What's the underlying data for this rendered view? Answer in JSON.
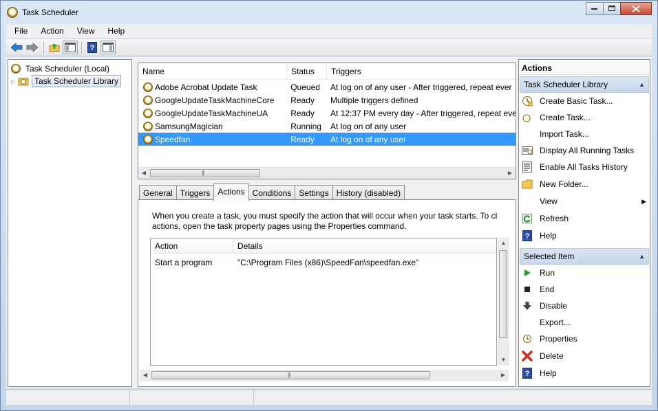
{
  "window": {
    "title": "Task Scheduler"
  },
  "menu": [
    "File",
    "Action",
    "View",
    "Help"
  ],
  "tree": {
    "root": "Task Scheduler (Local)",
    "library": "Task Scheduler Library"
  },
  "tasks": {
    "columns": [
      "Name",
      "Status",
      "Triggers"
    ],
    "rows": [
      {
        "name": "Adobe Acrobat Update Task",
        "status": "Queued",
        "triggers": "At log on of any user - After triggered, repeat ever"
      },
      {
        "name": "GoogleUpdateTaskMachineCore",
        "status": "Ready",
        "triggers": "Multiple triggers defined"
      },
      {
        "name": "GoogleUpdateTaskMachineUA",
        "status": "Ready",
        "triggers": "At 12:37 PM every day - After triggered, repeat eve"
      },
      {
        "name": "SamsungMagician",
        "status": "Running",
        "triggers": "At log on of any user"
      },
      {
        "name": "Speedfan",
        "status": "Ready",
        "triggers": "At log on of any user"
      }
    ],
    "selected_index": 4
  },
  "tabs": [
    "General",
    "Triggers",
    "Actions",
    "Conditions",
    "Settings",
    "History (disabled)"
  ],
  "active_tab": "Actions",
  "actions_tab": {
    "desc_line1": "When you create a task, you must specify the action that will occur when your task starts.  To cl",
    "desc_line2": "actions, open the task property pages using the Properties command.",
    "columns": [
      "Action",
      "Details"
    ],
    "row": {
      "action": "Start a program",
      "details": "\"C:\\Program Files (x86)\\SpeedFan\\speedfan.exe\""
    }
  },
  "actions_pane": {
    "title": "Actions",
    "section1": {
      "title": "Task Scheduler Library",
      "items": [
        {
          "label": "Create Basic Task...",
          "icon": "create-basic-task-icon"
        },
        {
          "label": "Create Task...",
          "icon": "create-task-icon"
        },
        {
          "label": "Import Task...",
          "icon": ""
        },
        {
          "label": "Display All Running Tasks",
          "icon": "running-tasks-icon"
        },
        {
          "label": "Enable All Tasks History",
          "icon": "history-icon"
        },
        {
          "label": "New Folder...",
          "icon": "folder-icon"
        },
        {
          "label": "View",
          "icon": ""
        },
        {
          "label": "Refresh",
          "icon": "refresh-icon"
        },
        {
          "label": "Help",
          "icon": "help-icon"
        }
      ]
    },
    "section2": {
      "title": "Selected Item",
      "items": [
        {
          "label": "Run",
          "icon": "run-icon"
        },
        {
          "label": "End",
          "icon": "end-icon"
        },
        {
          "label": "Disable",
          "icon": "disable-icon"
        },
        {
          "label": "Export...",
          "icon": ""
        },
        {
          "label": "Properties",
          "icon": "properties-icon"
        },
        {
          "label": "Delete",
          "icon": "delete-icon"
        },
        {
          "label": "Help",
          "icon": "help-icon"
        }
      ]
    }
  },
  "colors": {
    "selection": "#3399ff",
    "section_header": "#c7d6ea",
    "close_button": "#c74a33"
  }
}
